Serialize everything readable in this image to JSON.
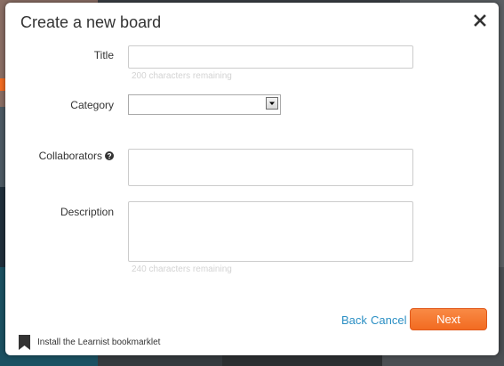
{
  "modal": {
    "title": "Create a new board",
    "close_icon": "close-icon"
  },
  "form": {
    "title": {
      "label": "Title",
      "value": "",
      "helper": "200 characters remaining"
    },
    "category": {
      "label": "Category",
      "selected": "",
      "arrow_icon": "chevron-down-icon"
    },
    "collaborators": {
      "label": "Collaborators",
      "help_icon": "question-circle-icon",
      "value": ""
    },
    "description": {
      "label": "Description",
      "value": "",
      "helper": "240 characters remaining"
    }
  },
  "actions": {
    "back_label": "Back",
    "cancel_label": "Cancel",
    "next_label": "Next"
  },
  "footer": {
    "bookmarklet_icon": "bookmark-icon",
    "bookmarklet_label": "Install the Learnist bookmarklet"
  },
  "colors": {
    "accent": "#f26b21",
    "link": "#2b8fc4",
    "helper_text": "#d3d3d3"
  }
}
